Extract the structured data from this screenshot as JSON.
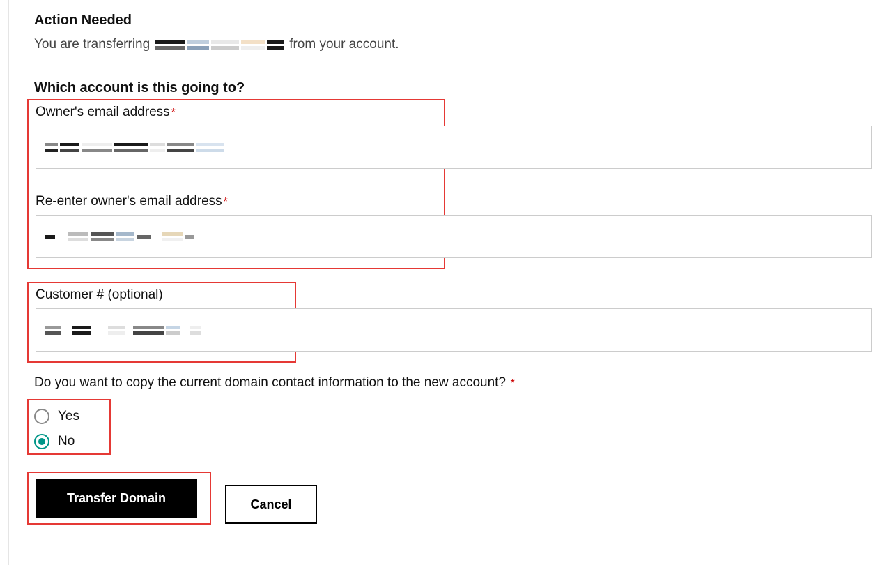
{
  "header": {
    "title": "Action Needed",
    "transfer_prefix": "You are transferring",
    "transfer_suffix": "from your account."
  },
  "account_section": {
    "question": "Which account is this going to?",
    "email_label": "Owner's email address",
    "reenter_label": "Re-enter owner's email address",
    "customer_label": "Customer # (optional)"
  },
  "copy_section": {
    "question": "Do you want to copy the current domain contact information to the new account?",
    "yes_label": "Yes",
    "no_label": "No",
    "selected": "no"
  },
  "buttons": {
    "transfer": "Transfer Domain",
    "cancel": "Cancel"
  }
}
